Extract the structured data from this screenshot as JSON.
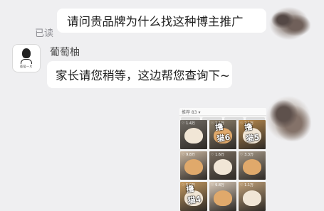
{
  "chat": {
    "outgoing_text": "请问贵品牌为什么找这种博主推广",
    "read_status": "已读",
    "sender_name": "葡萄柚",
    "reply_text": "家长请您稍等，这边帮您查询下~",
    "avatar_caption": "葡萄一片"
  },
  "image": {
    "header_text": "推荐 83 ▾",
    "tiles": [
      {
        "count": "♡ 1.4万",
        "label": "",
        "bg": "#6f6a63"
      },
      {
        "count": "♡ 1.1万",
        "label": "撸猫6",
        "bg": "#8c7f6a"
      },
      {
        "count": "♡ 2.1万",
        "label": "撸猫5",
        "bg": "#b98a4e"
      },
      {
        "count": "♡ 9.8万",
        "label": "",
        "bg": "#c9b6a0"
      },
      {
        "count": "♡ 1.6万",
        "label": "",
        "bg": "#7a6e60"
      },
      {
        "count": "♡ 3.3万",
        "label": "",
        "bg": "#a79a88"
      },
      {
        "count": "♡ 5.0万",
        "label": "撸猫4",
        "bg": "#c69b62"
      },
      {
        "count": "♡ 9.8万",
        "label": "",
        "bg": "#d8c9b8"
      },
      {
        "count": "♡ 1.1万",
        "label": "",
        "bg": "#c2a27a"
      }
    ]
  },
  "icons": {
    "avatar": "cartoon-person-avatar-icon",
    "obscured_avatar": "scribble-blur-icon"
  }
}
